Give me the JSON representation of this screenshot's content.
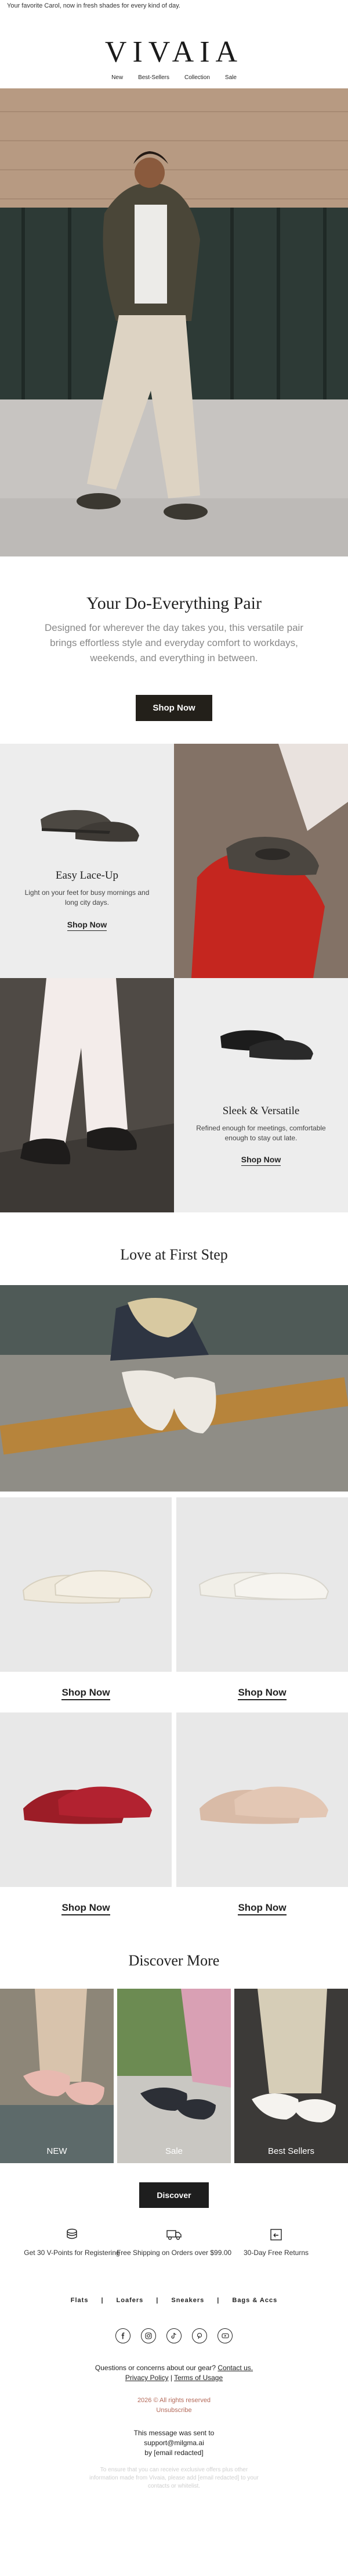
{
  "preheader": "Your favorite Carol, now in fresh shades for every kind of day.",
  "brand": {
    "logo": "VIVAIA"
  },
  "nav": [
    "New",
    "Best-Sellers",
    "Collection",
    "Sale"
  ],
  "intro": {
    "title": "Your Do-Everything Pair",
    "body": "Designed for wherever the day takes you, this versatile pair brings effortless style and everyday comfort to workdays, weekends, and everything in between.",
    "cta": "Shop Now"
  },
  "grid": {
    "easy": {
      "title": "Easy Lace-Up",
      "body": "Light on your feet for busy mornings and long city days.",
      "link": "Shop Now"
    },
    "sleek": {
      "title": "Sleek & Versatile",
      "body": "Refined enough for meetings, comfortable enough to stay out late.",
      "link": "Shop Now"
    }
  },
  "love": {
    "title": "Love at First Step"
  },
  "products": [
    {
      "link": "Shop Now",
      "color": "#efe9db"
    },
    {
      "link": "Shop Now",
      "color": "#f1efe8"
    },
    {
      "link": "Shop Now",
      "color": "#9c1d27"
    },
    {
      "link": "Shop Now",
      "color": "#d9bba7"
    }
  ],
  "discover": {
    "title": "Discover More",
    "tiles": [
      "NEW",
      "Sale",
      "Best Sellers"
    ],
    "cta": "Discover"
  },
  "benefits": [
    {
      "icon": "coins-icon",
      "text": "Get 30 V-Points for Registering"
    },
    {
      "icon": "truck-icon",
      "text": "Free Shipping on Orders over $99.00"
    },
    {
      "icon": "return-box-icon",
      "text": "30-Day Free Returns"
    }
  ],
  "categories": [
    "Flats",
    "Loafers",
    "Sneakers",
    "Bags & Accs"
  ],
  "socials": [
    "facebook-icon",
    "instagram-icon",
    "tiktok-icon",
    "pinterest-icon",
    "youtube-icon"
  ],
  "footer": {
    "question": "Questions or concerns about our gear?",
    "contact": "Contact us.",
    "privacy": "Privacy Policy",
    "sep": "|",
    "terms": "Terms of Usage",
    "copyright": "2026 © All rights reserved",
    "unsubscribe": "Unsubscribe",
    "sent_line1": "This message was sent to",
    "sent_line2": "support@milgma.ai",
    "sent_line3": "by [email redacted]",
    "fine": "To ensure that you can receive exclusive offers plus other information made from Vivaia, please add [email redacted] to your contacts or whitelist."
  }
}
